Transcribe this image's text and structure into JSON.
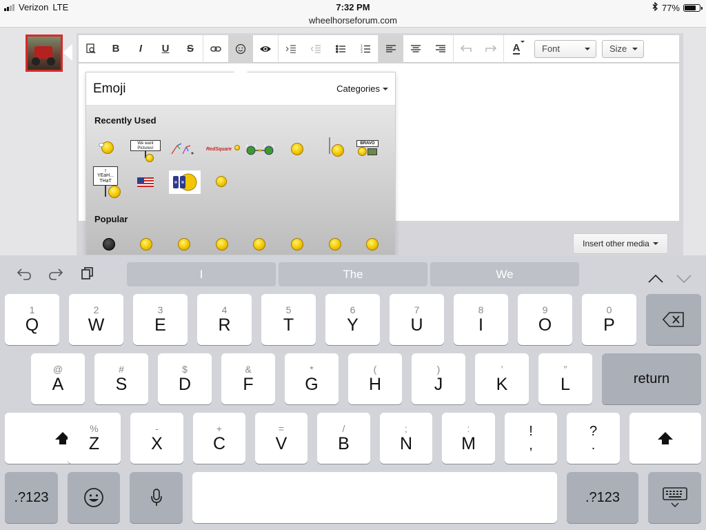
{
  "status_bar": {
    "carrier": "Verizon",
    "network": "LTE",
    "time": "7:32 PM",
    "battery_percent": "77%",
    "battery_level": 0.77,
    "bluetooth_icon": "bluetooth-icon"
  },
  "browser": {
    "url": "wheelhorseforum.com"
  },
  "toolbar": {
    "buttons": [
      "preview-icon",
      "bold",
      "italic",
      "underline",
      "strikethrough",
      "link-icon",
      "emoji-icon",
      "eye-icon",
      "indent-icon",
      "outdent-icon",
      "bullet-list-icon",
      "numbered-list-icon",
      "align-left-icon",
      "align-center-icon",
      "align-right-icon",
      "undo-icon",
      "redo-icon",
      "text-color-icon"
    ],
    "bold_label": "B",
    "italic_label": "I",
    "underline_label": "U",
    "strike_label": "S",
    "color_label": "A",
    "font_select": "Font",
    "size_select": "Size"
  },
  "emoji_popup": {
    "title": "Emoji",
    "categories_label": "Categories",
    "recently_used_label": "Recently Used",
    "popular_label": "Popular",
    "smilie_texts": {
      "we_want_pictures": "We want Pictures!",
      "redsquare": "RedSquare",
      "bravo": "BRAVO",
      "yeah_that": "YEaH... THaT"
    }
  },
  "editor": {
    "insert_media_label": "Insert other media"
  },
  "keyboard": {
    "suggestions": [
      "I",
      "The",
      "We"
    ],
    "row1": [
      {
        "alt": "1",
        "main": "Q"
      },
      {
        "alt": "2",
        "main": "W"
      },
      {
        "alt": "3",
        "main": "E"
      },
      {
        "alt": "4",
        "main": "R"
      },
      {
        "alt": "5",
        "main": "T"
      },
      {
        "alt": "6",
        "main": "Y"
      },
      {
        "alt": "7",
        "main": "U"
      },
      {
        "alt": "8",
        "main": "I"
      },
      {
        "alt": "9",
        "main": "O"
      },
      {
        "alt": "0",
        "main": "P"
      }
    ],
    "row2": [
      {
        "alt": "@",
        "main": "A"
      },
      {
        "alt": "#",
        "main": "S"
      },
      {
        "alt": "$",
        "main": "D"
      },
      {
        "alt": "&",
        "main": "F"
      },
      {
        "alt": "*",
        "main": "G"
      },
      {
        "alt": "(",
        "main": "H"
      },
      {
        "alt": ")",
        "main": "J"
      },
      {
        "alt": "’",
        "main": "K"
      },
      {
        "alt": "”",
        "main": "L"
      }
    ],
    "row3": [
      {
        "alt": "%",
        "main": "Z"
      },
      {
        "alt": "-",
        "main": "X"
      },
      {
        "alt": "+",
        "main": "C"
      },
      {
        "alt": "=",
        "main": "V"
      },
      {
        "alt": "/",
        "main": "B"
      },
      {
        "alt": ";",
        "main": "N"
      },
      {
        "alt": ":",
        "main": "M"
      }
    ],
    "punct_keys": [
      {
        "top": "!",
        "bottom": ","
      },
      {
        "top": "?",
        "bottom": "."
      }
    ],
    "return_label": "return",
    "numbers_label": ".?123"
  }
}
